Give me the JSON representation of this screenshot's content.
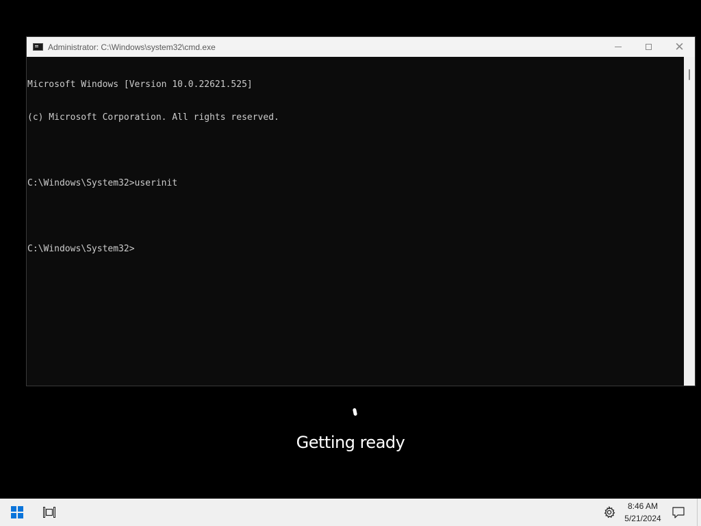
{
  "cmd_window": {
    "title": "Administrator: C:\\Windows\\system32\\cmd.exe",
    "minimize_label": "minimize",
    "maximize_label": "maximize",
    "close_label": "close",
    "console_lines": [
      "Microsoft Windows [Version 10.0.22621.525]",
      "(c) Microsoft Corporation. All rights reserved.",
      "",
      "C:\\Windows\\System32>userinit",
      "",
      "C:\\Windows\\System32>"
    ]
  },
  "overlay": {
    "status_text": "Getting ready"
  },
  "taskbar": {
    "icons": [
      "windows-start-icon",
      "task-view-icon",
      "settings-gear-icon",
      "notification-icon"
    ],
    "clock_time": "8:46 AM",
    "clock_date": "5/21/2024"
  },
  "colors": {
    "console_bg": "#0c0c0c",
    "console_text": "#cccccc",
    "titlebar_bg": "#f3f3f3",
    "taskbar_bg": "#f0f0f0",
    "start_accent": "#0a74da",
    "desktop_bg": "#000000"
  }
}
